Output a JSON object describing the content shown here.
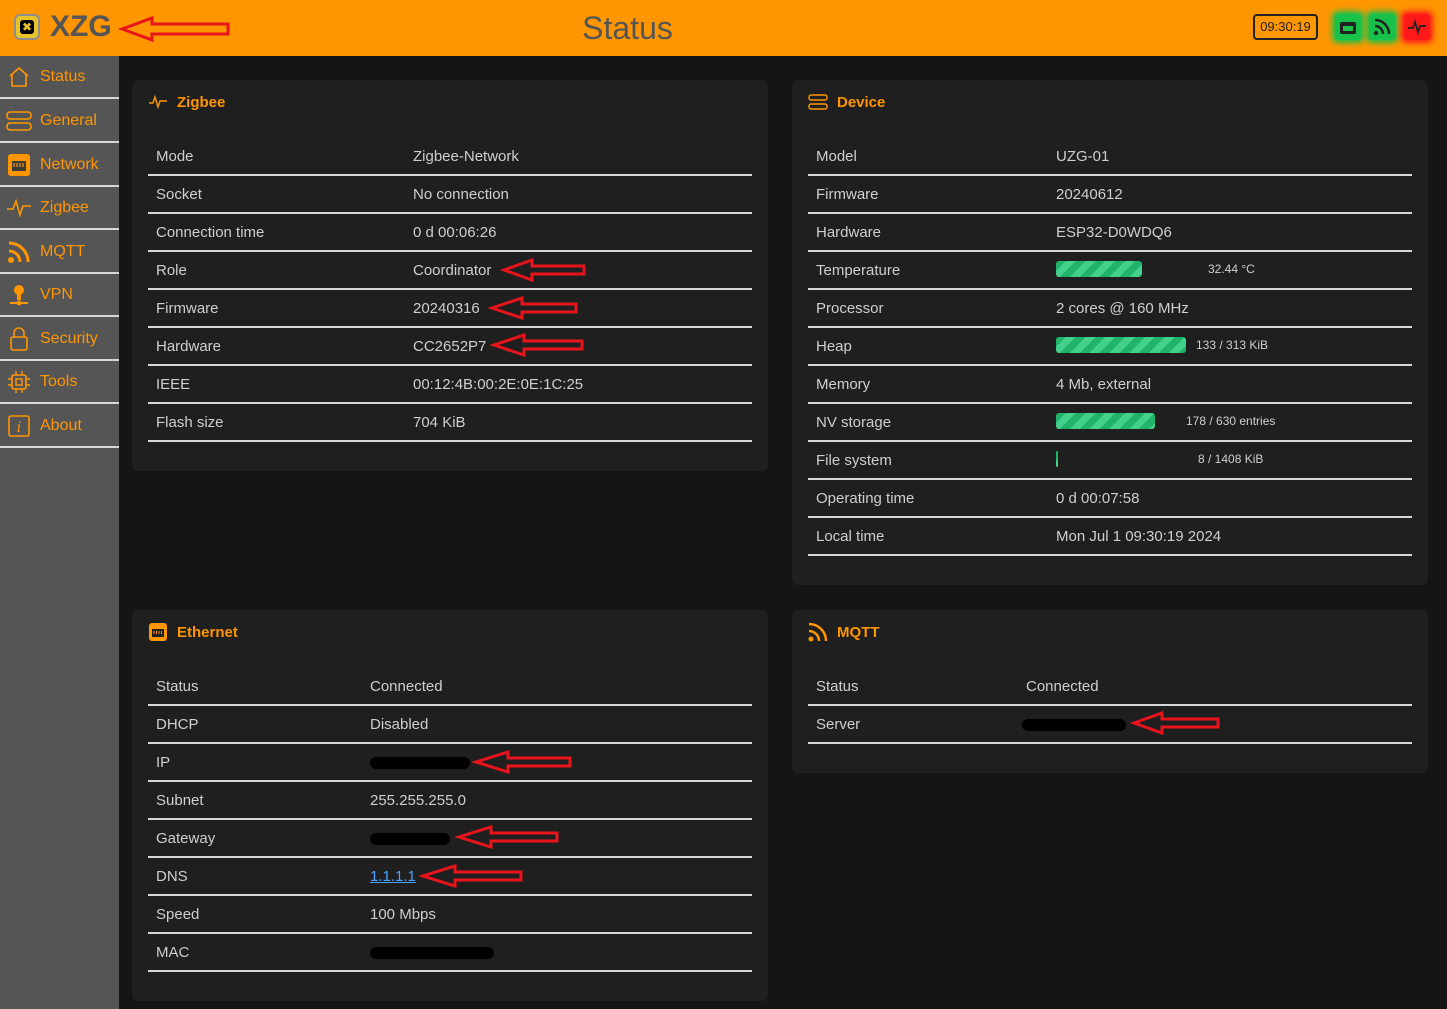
{
  "header": {
    "logo_text": "XZG",
    "title": "Status",
    "clock": "09:30:19"
  },
  "sidebar": {
    "items": [
      {
        "label": "Status",
        "icon": "home-icon"
      },
      {
        "label": "General",
        "icon": "server-icon"
      },
      {
        "label": "Network",
        "icon": "ethernet-icon"
      },
      {
        "label": "Zigbee",
        "icon": "pulse-icon"
      },
      {
        "label": "MQTT",
        "icon": "rss-icon"
      },
      {
        "label": "VPN",
        "icon": "vpn-icon"
      },
      {
        "label": "Security",
        "icon": "lock-icon"
      },
      {
        "label": "Tools",
        "icon": "chip-icon"
      },
      {
        "label": "About",
        "icon": "info-icon"
      }
    ]
  },
  "zigbee": {
    "title": "Zigbee",
    "rows": [
      {
        "k": "Mode",
        "v": "Zigbee-Network"
      },
      {
        "k": "Socket",
        "v": "No connection"
      },
      {
        "k": "Connection time",
        "v": "0 d 00:06:26"
      },
      {
        "k": "Role",
        "v": "Coordinator"
      },
      {
        "k": "Firmware",
        "v": "20240316"
      },
      {
        "k": "Hardware",
        "v": "CC2652P7"
      },
      {
        "k": "IEEE",
        "v": "00:12:4B:00:2E:0E:1C:25"
      },
      {
        "k": "Flash size",
        "v": "704 KiB"
      }
    ]
  },
  "device": {
    "title": "Device",
    "model": {
      "k": "Model",
      "v": "UZG-01"
    },
    "firmware": {
      "k": "Firmware",
      "v": "20240612"
    },
    "hardware": {
      "k": "Hardware",
      "v": "ESP32-D0WDQ6"
    },
    "temperature": {
      "k": "Temperature",
      "label": "32.44 °C",
      "fraction": 0.48
    },
    "processor": {
      "k": "Processor",
      "v": "2 cores @ 160 MHz"
    },
    "heap": {
      "k": "Heap",
      "label": "133 / 313 KiB",
      "fraction": 0.72
    },
    "memory": {
      "k": "Memory",
      "v": "4 Mb, external"
    },
    "nv_storage": {
      "k": "NV storage",
      "label": "178 / 630 entries",
      "fraction": 0.55
    },
    "file_system": {
      "k": "File system",
      "label": "8 / 1408 KiB",
      "fraction": 0.01
    },
    "operating_time": {
      "k": "Operating time",
      "v": "0 d 00:07:58"
    },
    "local_time": {
      "k": "Local time",
      "v": "Mon Jul 1 09:30:19 2024"
    }
  },
  "ethernet": {
    "title": "Ethernet",
    "status": {
      "k": "Status",
      "v": "Connected"
    },
    "dhcp": {
      "k": "DHCP",
      "v": "Disabled"
    },
    "ip": {
      "k": "IP"
    },
    "subnet": {
      "k": "Subnet",
      "v": "255.255.255.0"
    },
    "gateway": {
      "k": "Gateway"
    },
    "dns": {
      "k": "DNS",
      "v": "1.1.1.1"
    },
    "speed": {
      "k": "Speed",
      "v": "100 Mbps"
    },
    "mac": {
      "k": "MAC"
    }
  },
  "mqtt": {
    "title": "MQTT",
    "status": {
      "k": "Status",
      "v": "Connected"
    },
    "server": {
      "k": "Server"
    }
  },
  "colors": {
    "accent": "#ff9600",
    "ok": "#18c24a",
    "error": "#ff1a1a"
  }
}
